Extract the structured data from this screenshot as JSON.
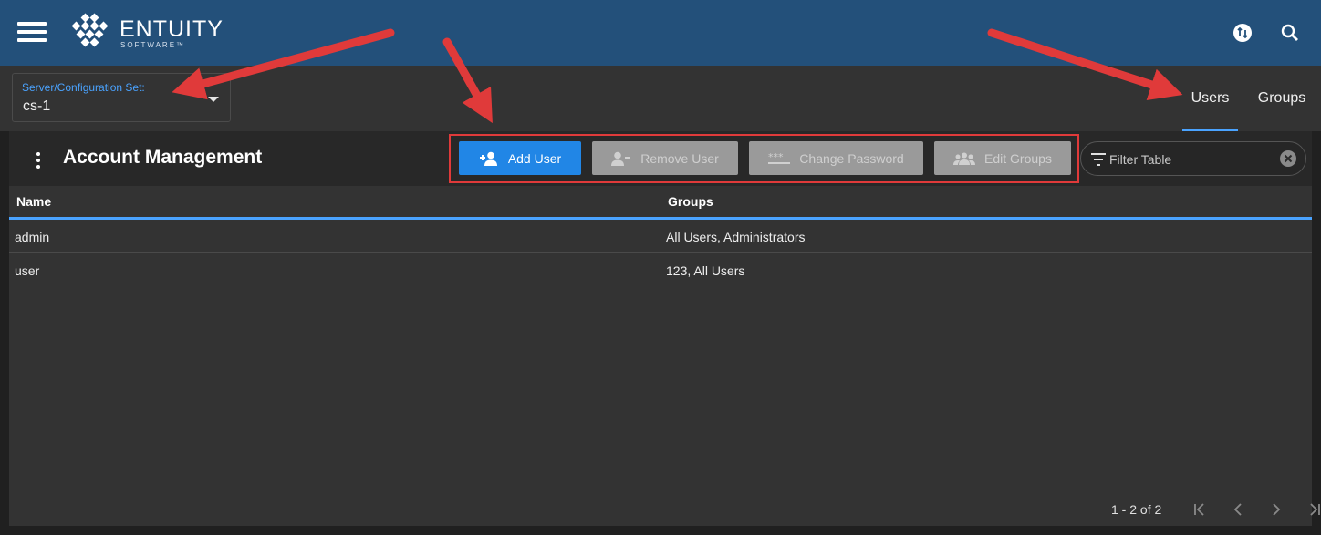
{
  "header": {
    "brand_name": "ENTUITY",
    "brand_sub": "SOFTWARE™",
    "icons": {
      "menu": "hamburger-menu-icon",
      "sync": "sync-icon",
      "search": "search-icon"
    }
  },
  "server_select": {
    "label": "Server/Configuration Set:",
    "value": "cs-1"
  },
  "tabs": [
    {
      "label": "Users",
      "active": true
    },
    {
      "label": "Groups",
      "active": false
    }
  ],
  "toolbar": {
    "title": "Account Management",
    "buttons": [
      {
        "label": "Add User",
        "icon": "add-user-icon",
        "enabled": true
      },
      {
        "label": "Remove User",
        "icon": "remove-user-icon",
        "enabled": false
      },
      {
        "label": "Change Password",
        "icon": "password-icon",
        "enabled": false
      },
      {
        "label": "Edit Groups",
        "icon": "groups-icon",
        "enabled": false
      }
    ],
    "filter": {
      "placeholder": "Filter Table",
      "value": ""
    }
  },
  "table": {
    "columns": [
      "Name",
      "Groups"
    ],
    "rows": [
      {
        "name": "admin",
        "groups": "All Users, Administrators"
      },
      {
        "name": "user",
        "groups": "123, All Users"
      }
    ],
    "pagination": {
      "text": "1 - 2 of 2"
    }
  },
  "colors": {
    "header_bg": "#23507a",
    "accent": "#4aa3ff",
    "primary_button": "#2186e6",
    "disabled_button": "#9a9a9a",
    "annotation": "#e03a3a"
  }
}
